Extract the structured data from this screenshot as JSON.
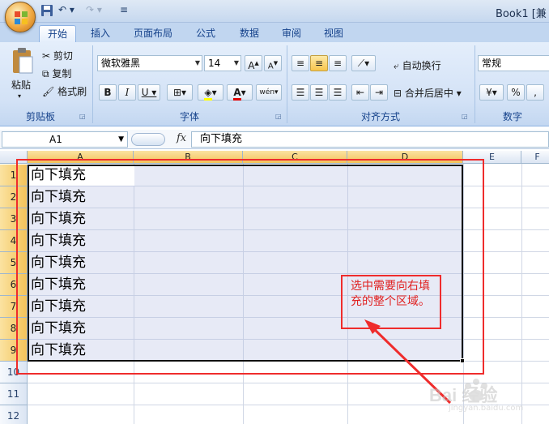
{
  "window": {
    "title_visible": "Book1  [兼"
  },
  "tabs": [
    "开始",
    "插入",
    "页面布局",
    "公式",
    "数据",
    "审阅",
    "视图"
  ],
  "clipboard": {
    "paste_label": "粘贴",
    "cut_label": "剪切",
    "copy_label": "复制",
    "format_painter_label": "格式刷",
    "group_label": "剪贴板"
  },
  "font": {
    "name": "微软雅黑",
    "size": "14",
    "group_label": "字体",
    "phonetic_label": "wén"
  },
  "alignment": {
    "wrap_label": "自动换行",
    "merge_label": "合并后居中",
    "group_label": "对齐方式"
  },
  "number": {
    "format": "常规",
    "percent": "%",
    "comma": ",",
    "group_label": "数字"
  },
  "formula_bar": {
    "name_box": "A1",
    "fx": "fx",
    "content": "向下填充"
  },
  "columns": [
    "A",
    "B",
    "C",
    "D",
    "E",
    "F"
  ],
  "rows": [
    "1",
    "2",
    "3",
    "4",
    "5",
    "6",
    "7",
    "8",
    "9",
    "10",
    "11",
    "12"
  ],
  "cells": [
    "向下填充",
    "向下填充",
    "向下填充",
    "向下填充",
    "向下填充",
    "向下填充",
    "向下填充",
    "向下填充",
    "向下填充"
  ],
  "annotation": {
    "callout": "选中需要向右填充的整个区域。"
  },
  "watermark": {
    "text": "Bai 经验",
    "url": "jingyan.baidu.com"
  },
  "colors": {
    "annotation_red": "#ef2c2c",
    "selection_fill": "#dcdff0",
    "ribbon": "#d3e2f6"
  }
}
